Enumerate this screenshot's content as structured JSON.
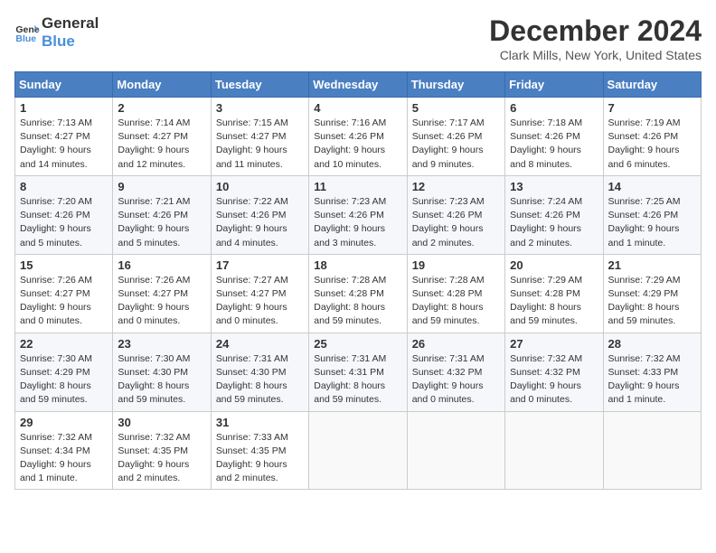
{
  "header": {
    "logo_line1": "General",
    "logo_line2": "Blue",
    "month_title": "December 2024",
    "location": "Clark Mills, New York, United States"
  },
  "weekdays": [
    "Sunday",
    "Monday",
    "Tuesday",
    "Wednesday",
    "Thursday",
    "Friday",
    "Saturday"
  ],
  "weeks": [
    [
      {
        "day": "1",
        "sunrise": "Sunrise: 7:13 AM",
        "sunset": "Sunset: 4:27 PM",
        "daylight": "Daylight: 9 hours and 14 minutes."
      },
      {
        "day": "2",
        "sunrise": "Sunrise: 7:14 AM",
        "sunset": "Sunset: 4:27 PM",
        "daylight": "Daylight: 9 hours and 12 minutes."
      },
      {
        "day": "3",
        "sunrise": "Sunrise: 7:15 AM",
        "sunset": "Sunset: 4:27 PM",
        "daylight": "Daylight: 9 hours and 11 minutes."
      },
      {
        "day": "4",
        "sunrise": "Sunrise: 7:16 AM",
        "sunset": "Sunset: 4:26 PM",
        "daylight": "Daylight: 9 hours and 10 minutes."
      },
      {
        "day": "5",
        "sunrise": "Sunrise: 7:17 AM",
        "sunset": "Sunset: 4:26 PM",
        "daylight": "Daylight: 9 hours and 9 minutes."
      },
      {
        "day": "6",
        "sunrise": "Sunrise: 7:18 AM",
        "sunset": "Sunset: 4:26 PM",
        "daylight": "Daylight: 9 hours and 8 minutes."
      },
      {
        "day": "7",
        "sunrise": "Sunrise: 7:19 AM",
        "sunset": "Sunset: 4:26 PM",
        "daylight": "Daylight: 9 hours and 6 minutes."
      }
    ],
    [
      {
        "day": "8",
        "sunrise": "Sunrise: 7:20 AM",
        "sunset": "Sunset: 4:26 PM",
        "daylight": "Daylight: 9 hours and 5 minutes."
      },
      {
        "day": "9",
        "sunrise": "Sunrise: 7:21 AM",
        "sunset": "Sunset: 4:26 PM",
        "daylight": "Daylight: 9 hours and 5 minutes."
      },
      {
        "day": "10",
        "sunrise": "Sunrise: 7:22 AM",
        "sunset": "Sunset: 4:26 PM",
        "daylight": "Daylight: 9 hours and 4 minutes."
      },
      {
        "day": "11",
        "sunrise": "Sunrise: 7:23 AM",
        "sunset": "Sunset: 4:26 PM",
        "daylight": "Daylight: 9 hours and 3 minutes."
      },
      {
        "day": "12",
        "sunrise": "Sunrise: 7:23 AM",
        "sunset": "Sunset: 4:26 PM",
        "daylight": "Daylight: 9 hours and 2 minutes."
      },
      {
        "day": "13",
        "sunrise": "Sunrise: 7:24 AM",
        "sunset": "Sunset: 4:26 PM",
        "daylight": "Daylight: 9 hours and 2 minutes."
      },
      {
        "day": "14",
        "sunrise": "Sunrise: 7:25 AM",
        "sunset": "Sunset: 4:26 PM",
        "daylight": "Daylight: 9 hours and 1 minute."
      }
    ],
    [
      {
        "day": "15",
        "sunrise": "Sunrise: 7:26 AM",
        "sunset": "Sunset: 4:27 PM",
        "daylight": "Daylight: 9 hours and 0 minutes."
      },
      {
        "day": "16",
        "sunrise": "Sunrise: 7:26 AM",
        "sunset": "Sunset: 4:27 PM",
        "daylight": "Daylight: 9 hours and 0 minutes."
      },
      {
        "day": "17",
        "sunrise": "Sunrise: 7:27 AM",
        "sunset": "Sunset: 4:27 PM",
        "daylight": "Daylight: 9 hours and 0 minutes."
      },
      {
        "day": "18",
        "sunrise": "Sunrise: 7:28 AM",
        "sunset": "Sunset: 4:28 PM",
        "daylight": "Daylight: 8 hours and 59 minutes."
      },
      {
        "day": "19",
        "sunrise": "Sunrise: 7:28 AM",
        "sunset": "Sunset: 4:28 PM",
        "daylight": "Daylight: 8 hours and 59 minutes."
      },
      {
        "day": "20",
        "sunrise": "Sunrise: 7:29 AM",
        "sunset": "Sunset: 4:28 PM",
        "daylight": "Daylight: 8 hours and 59 minutes."
      },
      {
        "day": "21",
        "sunrise": "Sunrise: 7:29 AM",
        "sunset": "Sunset: 4:29 PM",
        "daylight": "Daylight: 8 hours and 59 minutes."
      }
    ],
    [
      {
        "day": "22",
        "sunrise": "Sunrise: 7:30 AM",
        "sunset": "Sunset: 4:29 PM",
        "daylight": "Daylight: 8 hours and 59 minutes."
      },
      {
        "day": "23",
        "sunrise": "Sunrise: 7:30 AM",
        "sunset": "Sunset: 4:30 PM",
        "daylight": "Daylight: 8 hours and 59 minutes."
      },
      {
        "day": "24",
        "sunrise": "Sunrise: 7:31 AM",
        "sunset": "Sunset: 4:30 PM",
        "daylight": "Daylight: 8 hours and 59 minutes."
      },
      {
        "day": "25",
        "sunrise": "Sunrise: 7:31 AM",
        "sunset": "Sunset: 4:31 PM",
        "daylight": "Daylight: 8 hours and 59 minutes."
      },
      {
        "day": "26",
        "sunrise": "Sunrise: 7:31 AM",
        "sunset": "Sunset: 4:32 PM",
        "daylight": "Daylight: 9 hours and 0 minutes."
      },
      {
        "day": "27",
        "sunrise": "Sunrise: 7:32 AM",
        "sunset": "Sunset: 4:32 PM",
        "daylight": "Daylight: 9 hours and 0 minutes."
      },
      {
        "day": "28",
        "sunrise": "Sunrise: 7:32 AM",
        "sunset": "Sunset: 4:33 PM",
        "daylight": "Daylight: 9 hours and 1 minute."
      }
    ],
    [
      {
        "day": "29",
        "sunrise": "Sunrise: 7:32 AM",
        "sunset": "Sunset: 4:34 PM",
        "daylight": "Daylight: 9 hours and 1 minute."
      },
      {
        "day": "30",
        "sunrise": "Sunrise: 7:32 AM",
        "sunset": "Sunset: 4:35 PM",
        "daylight": "Daylight: 9 hours and 2 minutes."
      },
      {
        "day": "31",
        "sunrise": "Sunrise: 7:33 AM",
        "sunset": "Sunset: 4:35 PM",
        "daylight": "Daylight: 9 hours and 2 minutes."
      },
      null,
      null,
      null,
      null
    ]
  ]
}
